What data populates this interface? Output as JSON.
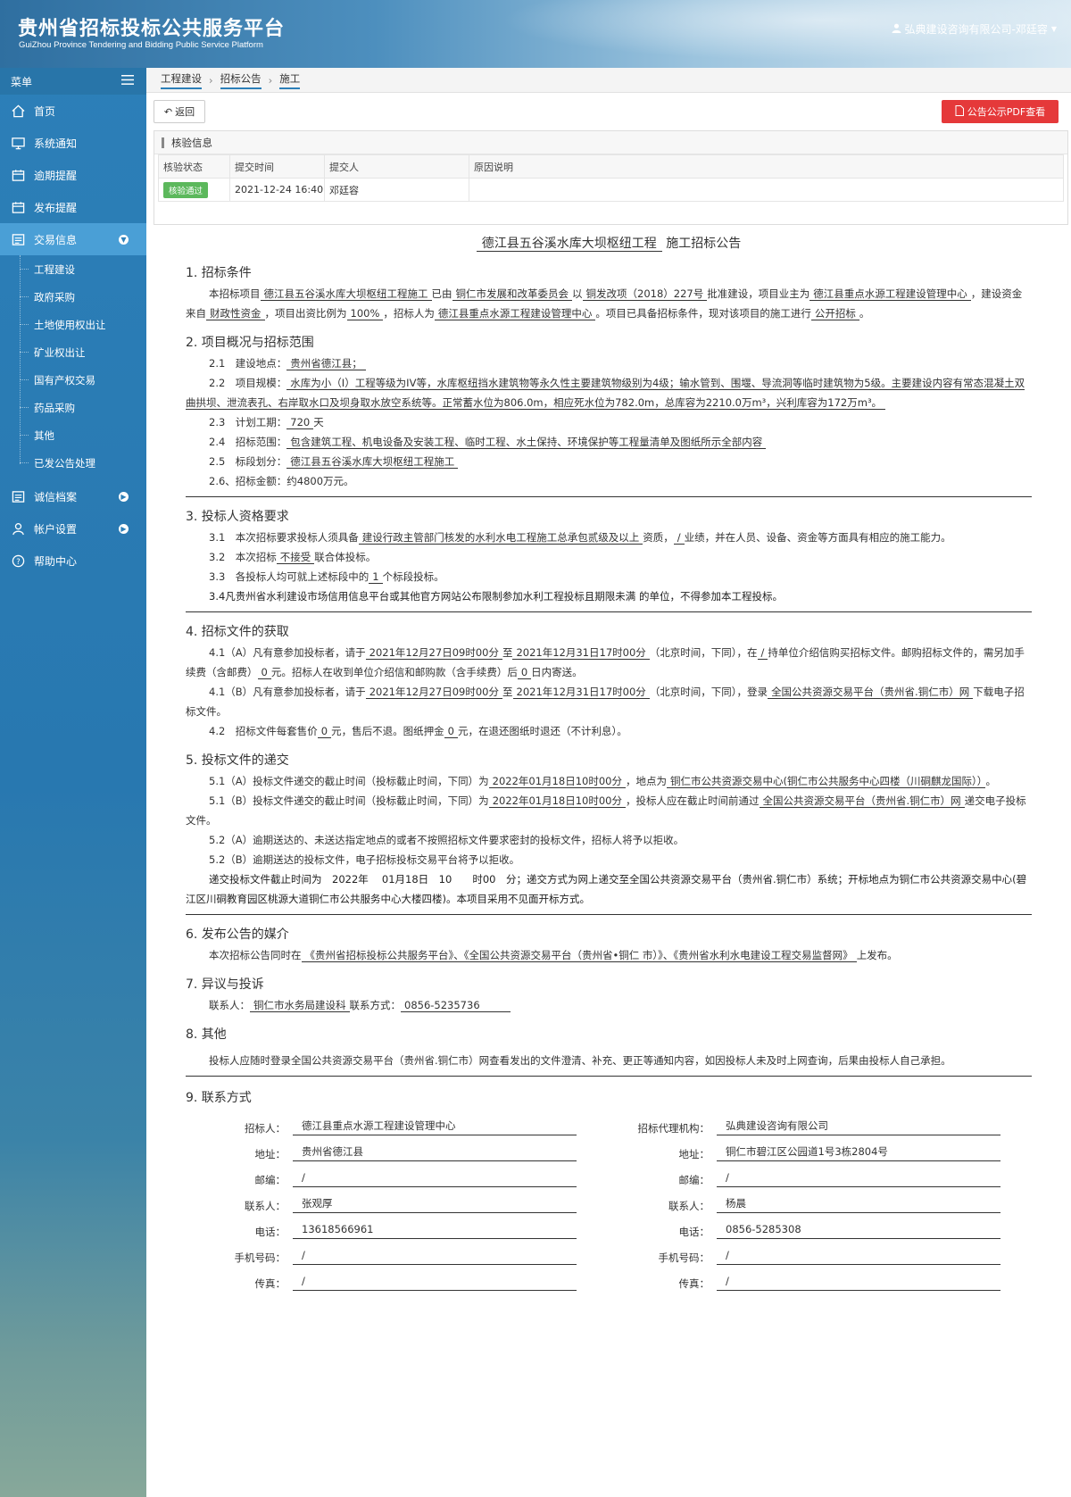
{
  "header": {
    "title": "贵州省招标投标公共服务平台",
    "subtitle": "GuiZhou Province Tendering and Bidding Public Service Platform",
    "user": "弘典建设咨询有限公司-邓廷容"
  },
  "sidebar": {
    "menu_label": "菜单",
    "items": [
      {
        "label": "首页"
      },
      {
        "label": "系统通知"
      },
      {
        "label": "逾期提醒"
      },
      {
        "label": "发布提醒"
      },
      {
        "label": "交易信息"
      }
    ],
    "sub_items": [
      "工程建设",
      "政府采购",
      "土地使用权出让",
      "矿业权出让",
      "国有产权交易",
      "药品采购",
      "其他",
      "已发公告处理"
    ],
    "items_after": [
      {
        "label": "诚信档案"
      },
      {
        "label": "帐户设置"
      },
      {
        "label": "帮助中心"
      }
    ]
  },
  "breadcrumb": [
    "工程建设",
    "招标公告",
    "施工"
  ],
  "toolbar": {
    "back_label": "返回",
    "pdf_label": "公告公示PDF查看"
  },
  "verify": {
    "title": "核验信息",
    "columns": [
      "核验状态",
      "提交时间",
      "提交人",
      "原因说明"
    ],
    "row": {
      "status": "核验通过",
      "time": "2021-12-24 16:40",
      "submitter": "邓廷容",
      "reason": ""
    }
  },
  "doc": {
    "title_project": "德江县五谷溪水库大坝枢纽工程",
    "title_suffix": "施工招标公告",
    "s1": {
      "heading": "1. 招标条件",
      "t1": "本招标项目",
      "project": "德江县五谷溪水库大坝枢纽工程施工",
      "t2": "已由",
      "approver": "铜仁市发展和改革委员会",
      "t3": "以",
      "doc_no": "铜发改项（2018）227号",
      "t4": "批准建设，项目业主为",
      "owner": "德江县重点水源工程建设管理中心",
      "t5": "，建设资金来自",
      "fund": "财政性资金",
      "t6": "，项目出资比例为",
      "ratio": "100%",
      "t7": "，招标人为",
      "tenderer": "德江县重点水源工程建设管理中心",
      "t8": "。项目已具备招标条件，现对该项目的施工进行",
      "method": "公开招标",
      "t9": "。"
    },
    "s2": {
      "heading": "2. 项目概况与招标范围",
      "l1_label": "2.1　建设地点：",
      "l1": "贵州省德江县；",
      "l2_label": "2.2　项目规模：",
      "l2": "水库为小（I）工程等级为IV等，水库枢纽挡水建筑物等永久性主要建筑物级别为4级；输水管到、围堰、导流洞等临时建筑物为5级。主要建设内容有常态混凝土双曲拱坝、泄流表孔、右岸取水口及坝身取水放空系统等。正常蓄水位为806.0m，相应死水位为782.0m，总库容为2210.0万m³，兴利库容为172万m³。",
      "l3_label": "2.3　计划工期：",
      "l3": "720",
      "l3_unit": "天",
      "l4_label": "2.4　招标范围：",
      "l4": "包含建筑工程、机电设备及安装工程、临时工程、水土保持、环境保护等工程量清单及图纸所示全部内容",
      "l5_label": "2.5　标段划分：",
      "l5": "德江县五谷溪水库大坝枢纽工程施工",
      "l6": "2.6、招标金额：约4800万元。"
    },
    "s3": {
      "heading": "3. 投标人资格要求",
      "l1a": "3.1　本次招标要求投标人须具备",
      "l1q": "建设行政主管部门核发的水利水电工程施工总承包贰级及以上",
      "l1b": "资质，",
      "l1c": "/",
      "l1d": "业绩，并在人员、设备、资金等方面具有相应的施工能力。",
      "l2a": "3.2　本次招标",
      "l2b": "不接受",
      "l2c": "联合体投标。",
      "l3a": "3.3　各投标人均可就上述标段中的",
      "l3b": "1",
      "l3c": "个标段投标。",
      "l4": "3.4凡贵州省水利建设市场信用信息平台或其他官方网站公布限制参加水利工程投标且期限未满 的单位，不得参加本工程投标。"
    },
    "s4": {
      "heading": "4. 招标文件的获取",
      "a1": "4.1（A）凡有意参加投标者，请于",
      "a_start": "2021年12月27日09时00分",
      "a2": "至",
      "a_end": "2021年12月31日17时00分",
      "a3": "（北京时间，下同），在",
      "a_place": "/",
      "a4": "持单位介绍信购买招标文件。邮购招标文件的，需另加手续费（含邮费）",
      "a_fee": "0",
      "a5": "元。招标人在收到单位介绍信和邮购款（含手续费）后",
      "a_days": "0",
      "a6": "日内寄送。",
      "b1": "4.1（B）凡有意参加投标者，请于",
      "b_start": "2021年12月27日09时00分",
      "b2": "至",
      "b_end": "2021年12月31日17时00分",
      "b3": "（北京时间，下同），登录",
      "b_site": "全国公共资源交易平台（贵州省.铜仁市）网",
      "b4": "下载电子招标文件。",
      "c1": "4.2　招标文件每套售价",
      "c_price": "0",
      "c2": "元，售后不退。图纸押金",
      "c_dep": "0",
      "c3": "元，在退还图纸时退还（不计利息）。"
    },
    "s5": {
      "heading": "5. 投标文件的递交",
      "a1": "5.1（A）投标文件递交的截止时间（投标截止时间，下同）为",
      "a_time": "2022年01月18日10时00分",
      "a2": "，地点为",
      "a_place": "铜仁市公共资源交易中心(铜仁市公共服务中心四楼（川硐麒龙国际））",
      "a3": "。",
      "b1": "5.1（B）投标文件递交的截止时间（投标截止时间，下同）为",
      "b_time": "2022年01月18日10时00分",
      "b2": "，投标人应在截止时间前通过",
      "b_site": "全国公共资源交易平台（贵州省.铜仁市）网",
      "b3": "递交电子投标文件。",
      "c": "5.2（A）逾期送达的、未送达指定地点的或者不按照招标文件要求密封的投标文件，招标人将予以拒收。",
      "d": "5.2（B）逾期送达的投标文件，电子招标投标交易平台将予以拒收。",
      "e": "递交投标文件截止时间为　2022年　 01月18日　10　　时00　分；递交方式为网上递交至全国公共资源交易平台（贵州省.铜仁市）系统；开标地点为铜仁市公共资源交易中心(碧江区川硐教育园区桃源大道铜仁市公共服务中心大楼四楼)。本项目采用不见面开标方式。"
    },
    "s6": {
      "heading": "6. 发布公告的媒介",
      "t1": "本次招标公告同时在",
      "media": "《贵州省招标投标公共服务平台》、《全国公共资源交易平台（贵州省•铜仁 市）》、《贵州省水利水电建设工程交易监督网》",
      "t2": "上发布。"
    },
    "s7": {
      "heading": "7. 异议与投诉",
      "l1": "联系人：",
      "contact": "铜仁市水务局建设科",
      "l2": "联系方式：",
      "phone": "0856-5235736"
    },
    "s8": {
      "heading": "8. 其他",
      "text": "投标人应随时登录全国公共资源交易平台（贵州省.铜仁市）网查看发出的文件澄清、补充、更正等通知内容，如因投标人未及时上网查询，后果由投标人自己承担。"
    },
    "s9": {
      "heading": "9. 联系方式",
      "left": [
        {
          "label": "招标人：",
          "value": "德江县重点水源工程建设管理中心"
        },
        {
          "label": "地址：",
          "value": "贵州省德江县"
        },
        {
          "label": "邮编：",
          "value": "/"
        },
        {
          "label": "联系人：",
          "value": "张观厚"
        },
        {
          "label": "电话：",
          "value": "13618566961"
        },
        {
          "label": "手机号码：",
          "value": "/"
        },
        {
          "label": "传真：",
          "value": "/"
        }
      ],
      "right": [
        {
          "label": "招标代理机构：",
          "value": "弘典建设咨询有限公司"
        },
        {
          "label": "地址：",
          "value": "铜仁市碧江区公园道1号3栋2804号"
        },
        {
          "label": "邮编：",
          "value": "/"
        },
        {
          "label": "联系人：",
          "value": "杨晨"
        },
        {
          "label": "电话：",
          "value": "0856-5285308"
        },
        {
          "label": "手机号码：",
          "value": "/"
        },
        {
          "label": "传真：",
          "value": "/"
        }
      ]
    }
  }
}
